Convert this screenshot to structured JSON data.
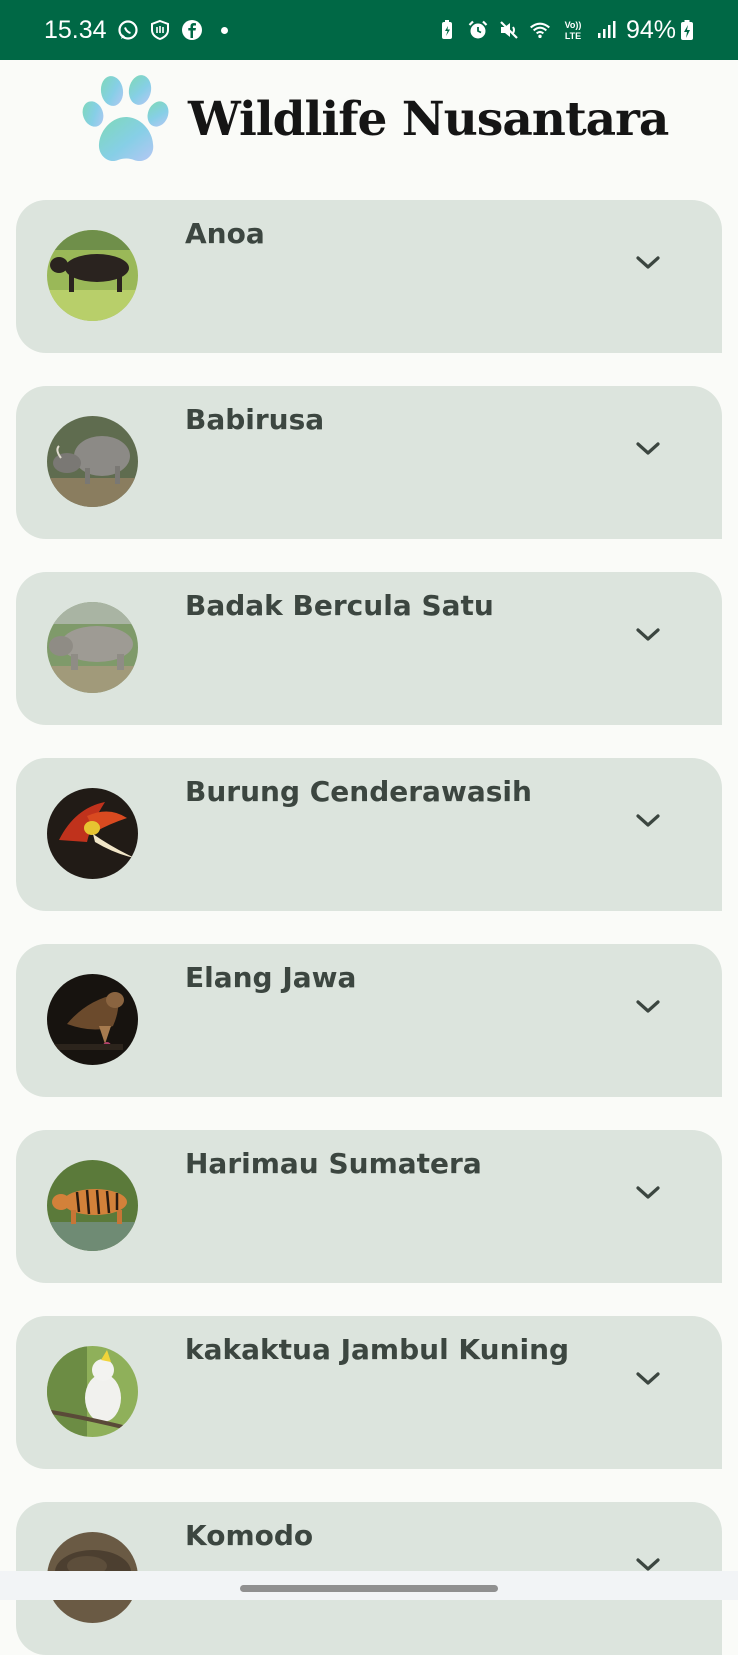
{
  "status_bar": {
    "time": "15.34",
    "battery": "94%",
    "icons_left": [
      "whatsapp-icon",
      "shield-icon",
      "facebook-icon",
      "notification-dot"
    ],
    "icons_right": [
      "battery-saver-icon",
      "alarm-icon",
      "mute-icon",
      "wifi-icon",
      "volte-icon",
      "signal-icon",
      "charging-battery-icon"
    ],
    "volte_label": "Vo))\nLTE"
  },
  "header": {
    "title": "Wildlife Nusantara",
    "logo_icon": "paw-icon"
  },
  "animals": [
    {
      "name": "Anoa",
      "expand_icon": "chevron-down-icon"
    },
    {
      "name": "Babirusa",
      "expand_icon": "chevron-down-icon"
    },
    {
      "name": "Badak Bercula Satu",
      "expand_icon": "chevron-down-icon"
    },
    {
      "name": "Burung Cenderawasih",
      "expand_icon": "chevron-down-icon"
    },
    {
      "name": "Elang Jawa",
      "expand_icon": "chevron-down-icon"
    },
    {
      "name": "Harimau Sumatera",
      "expand_icon": "chevron-down-icon"
    },
    {
      "name": "kakaktua Jambul Kuning",
      "expand_icon": "chevron-down-icon"
    },
    {
      "name": "Komodo",
      "expand_icon": "chevron-down-icon"
    }
  ],
  "colors": {
    "status_bar": "#006845",
    "background": "#fafbf8",
    "card": "#dce4dd",
    "card_text": "#3c4640",
    "title_text": "#151515"
  }
}
